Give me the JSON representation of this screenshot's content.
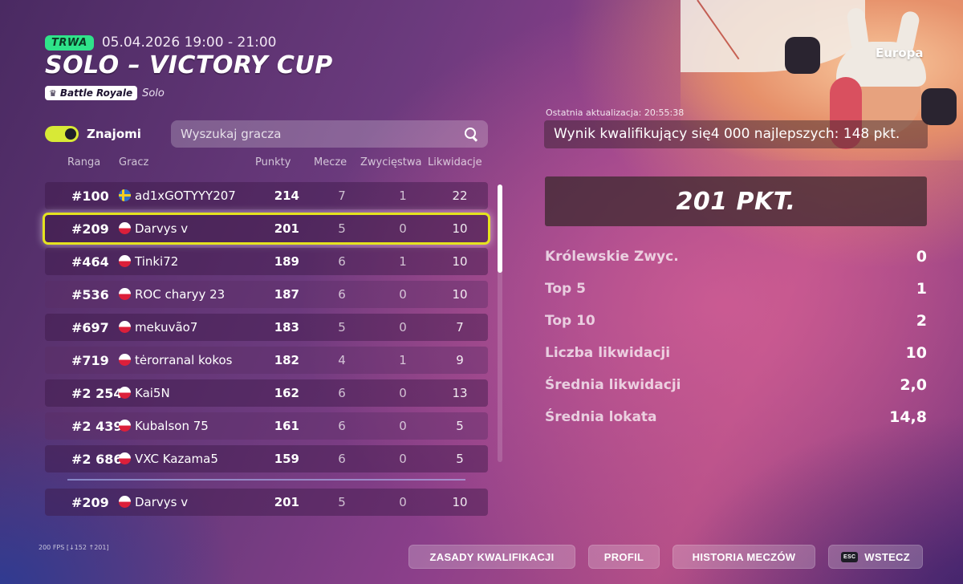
{
  "header": {
    "status_badge": "TRWA",
    "date_range": "05.04.2026 19:00 - 21:00",
    "title": "SOLO – VICTORY CUP",
    "mode_label": "Battle Royale",
    "mode_sub": "Solo",
    "mode_icon": "crown-icon"
  },
  "controls": {
    "friends_toggle_label": "Znajomi",
    "friends_toggle_on": true,
    "search_placeholder": "Wyszukaj gracza"
  },
  "table": {
    "columns": {
      "rank": "Ranga",
      "player": "Gracz",
      "points": "Punkty",
      "matches": "Mecze",
      "wins": "Zwycięstwa",
      "eliminations": "Likwidacje"
    },
    "rows": [
      {
        "rank": "#100",
        "flag": "SE",
        "name": "ad1xGOTYYY207",
        "points": "214",
        "matches": "7",
        "wins": "1",
        "elims": "22"
      },
      {
        "rank": "#209",
        "flag": "PL",
        "name": "Darvys v",
        "points": "201",
        "matches": "5",
        "wins": "0",
        "elims": "10"
      },
      {
        "rank": "#464",
        "flag": "PL",
        "name": "Tinki72",
        "points": "189",
        "matches": "6",
        "wins": "1",
        "elims": "10"
      },
      {
        "rank": "#536",
        "flag": "PL",
        "name": "ROC charyy 23",
        "points": "187",
        "matches": "6",
        "wins": "0",
        "elims": "10"
      },
      {
        "rank": "#697",
        "flag": "PL",
        "name": "mekuvão7",
        "points": "183",
        "matches": "5",
        "wins": "0",
        "elims": "7"
      },
      {
        "rank": "#719",
        "flag": "PL",
        "name": "tėrorranal kokos",
        "points": "182",
        "matches": "4",
        "wins": "1",
        "elims": "9"
      },
      {
        "rank": "#2 254",
        "flag": "PL",
        "name": "Kai5N",
        "points": "162",
        "matches": "6",
        "wins": "0",
        "elims": "13"
      },
      {
        "rank": "#2 439",
        "flag": "PL",
        "name": "Kubalson 75",
        "points": "161",
        "matches": "6",
        "wins": "0",
        "elims": "5"
      },
      {
        "rank": "#2 686",
        "flag": "PL",
        "name": "VXC Kazama5",
        "points": "159",
        "matches": "6",
        "wins": "0",
        "elims": "5"
      }
    ],
    "highlighted_rank": "#209",
    "my_row": {
      "rank": "#209",
      "flag": "PL",
      "name": "Darvys v",
      "points": "201",
      "matches": "5",
      "wins": "0",
      "elims": "10"
    }
  },
  "panel": {
    "region": "Europa",
    "last_update": "Ostatnia aktualizacja: 20:55:38",
    "qualifying_text": "Wynik kwalifikujący się4 000 najlepszych: 148 pkt.",
    "score": "201 PKT.",
    "stats": [
      {
        "label": "Królewskie Zwyc.",
        "value": "0"
      },
      {
        "label": "Top 5",
        "value": "1"
      },
      {
        "label": "Top 10",
        "value": "2"
      },
      {
        "label": "Liczba likwidacji",
        "value": "10"
      },
      {
        "label": "Średnia likwidacji",
        "value": "2,0"
      },
      {
        "label": "Średnia lokata",
        "value": "14,8"
      }
    ]
  },
  "footer": {
    "fps": "200 FPS [↓152 ↑201]",
    "rules_button": "ZASADY KWALIFIKACJI",
    "profile_button": "PROFIL",
    "history_button": "HISTORIA MECZÓW",
    "back_button": "WSTECZ",
    "esc_key": "ESC"
  },
  "colors": {
    "live_badge": "#2fe38a",
    "toggle_on": "#d8e936",
    "highlight_outline": "#e5e31f"
  }
}
